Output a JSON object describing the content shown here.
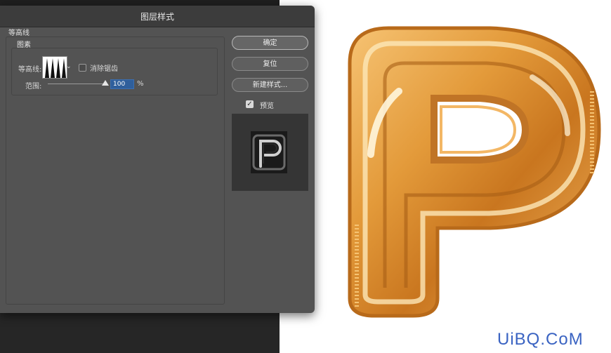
{
  "dialog": {
    "title": "图层样式",
    "section_label": "等高线",
    "group_label": "图素",
    "contour_label": "等高线:",
    "contour_dropdown_icon": "chevron-down-icon",
    "anti_alias_label": "消除锯齿",
    "anti_alias_checked": false,
    "range_label": "范围:",
    "range_value": "100",
    "range_unit": "%",
    "range_fraction": 1.0
  },
  "buttons": {
    "ok_label": "确定",
    "reset_label": "复位",
    "new_style_label": "新建样式..."
  },
  "preview": {
    "label": "预览",
    "checked": true
  },
  "watermark": {
    "text": "UiBQ.CoM",
    "color": "#3a63c2"
  },
  "colors": {
    "dialog_bg": "#535353",
    "titlebar_bg": "#3c3c3c",
    "range_input_bg": "#2f5f9c",
    "balloon_gold": "#d9882a"
  }
}
